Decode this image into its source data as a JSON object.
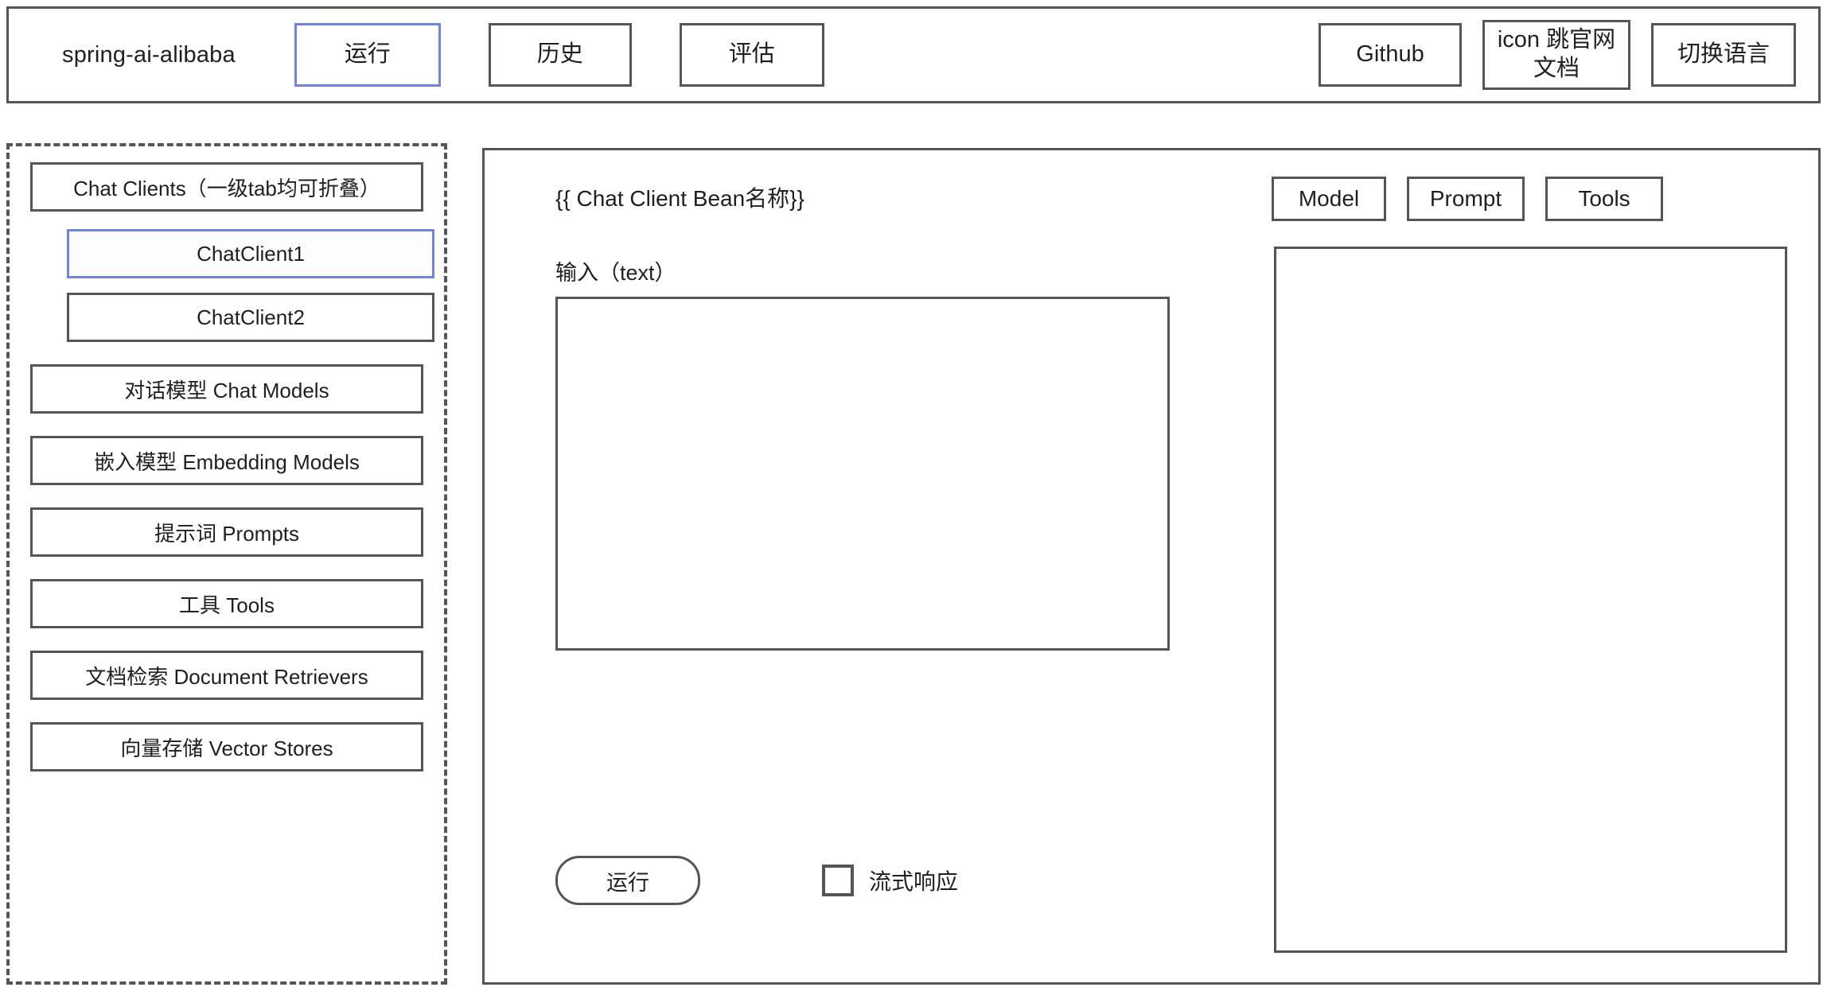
{
  "header": {
    "brand": "spring-ai-alibaba",
    "left_tabs": [
      {
        "label": "运行",
        "selected": true
      },
      {
        "label": "历史",
        "selected": false
      },
      {
        "label": "评估",
        "selected": false
      }
    ],
    "right_buttons": {
      "github": "Github",
      "docs_line1": "icon 跳官网",
      "docs_line2": "文档",
      "language": "切换语言"
    }
  },
  "sidebar": {
    "items": [
      {
        "label": "Chat Clients（一级tab均可折叠）",
        "level": 1,
        "selected": false
      },
      {
        "label": "ChatClient1",
        "level": 2,
        "selected": true
      },
      {
        "label": "ChatClient2",
        "level": 2,
        "selected": false
      },
      {
        "label": "对话模型 Chat Models",
        "level": 1,
        "selected": false
      },
      {
        "label": "嵌入模型 Embedding Models",
        "level": 1,
        "selected": false
      },
      {
        "label": "提示词 Prompts",
        "level": 1,
        "selected": false
      },
      {
        "label": "工具 Tools",
        "level": 1,
        "selected": false
      },
      {
        "label": "文档检索 Document Retrievers",
        "level": 1,
        "selected": false
      },
      {
        "label": "向量存储 Vector Stores",
        "level": 1,
        "selected": false
      }
    ]
  },
  "main": {
    "bean_title": "{{ Chat Client Bean名称}}",
    "input_label": "输入（text）",
    "input_value": "",
    "input_placeholder": "",
    "run_button": "运行",
    "stream_label": "流式响应",
    "stream_checked": false
  },
  "right_panel": {
    "tabs": [
      {
        "label": "Model"
      },
      {
        "label": "Prompt"
      },
      {
        "label": "Tools"
      }
    ],
    "output_value": ""
  },
  "colors": {
    "accent": "#7084dd",
    "border": "#555555",
    "background": "#ffffff",
    "text": "#1f1f1f"
  }
}
